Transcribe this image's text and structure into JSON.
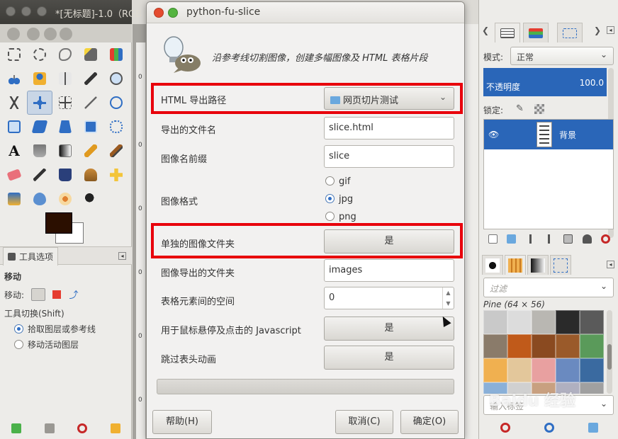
{
  "background_window": {
    "title": "*[无标题]-1.0（RGB"
  },
  "toolbox": {
    "tool_options_tab": "工具选项",
    "move_section_title": "移动",
    "move_label": "移动:",
    "tool_toggle_label": "工具切换(Shift)",
    "option_pick_layer": "拾取图层或参考线",
    "option_move_active": "移动活动图层",
    "ruler_marks": [
      "0",
      "0",
      "0",
      "0",
      "0",
      "0"
    ]
  },
  "layers_panel": {
    "mode_label": "模式:",
    "mode_value": "正常",
    "opacity_label": "不透明度",
    "opacity_value": "100.0",
    "lock_label": "锁定:",
    "layer_name": "背景"
  },
  "patterns_panel": {
    "filter_placeholder": "过滤",
    "pattern_name": "Pine (64 × 56)",
    "tag_placeholder": "输入标签"
  },
  "dialog": {
    "title": "python-fu-slice",
    "description": "沿参考线切割图像，创建多幅图像及 HTML 表格片段",
    "fields": {
      "html_path_label": "HTML 导出路径",
      "html_path_value": "网页切片测试",
      "filename_label": "导出的文件名",
      "filename_value": "slice.html",
      "prefix_label": "图像名前缀",
      "prefix_value": "slice",
      "format_label": "图像格式",
      "format_options": [
        "gif",
        "jpg",
        "png"
      ],
      "format_selected": "jpg",
      "separate_folder_label": "单独的图像文件夹",
      "separate_folder_value": "是",
      "image_folder_label": "图像导出的文件夹",
      "image_folder_value": "images",
      "cell_space_label": "表格元素间的空间",
      "cell_space_value": "0",
      "javascript_label": "用于鼠标悬停及点击的 Javascript",
      "javascript_value": "是",
      "skip_caps_label": "跳过表头动画",
      "skip_caps_value": "是"
    },
    "buttons": {
      "help": "帮助(H)",
      "cancel": "取消(C)",
      "ok": "确定(O)"
    }
  },
  "watermark": "Baidu 经验",
  "colors": {
    "highlight": "#e8000b",
    "selection": "#2a66b8",
    "foreground_color": "#2b0f00",
    "background_color": "#ffffff"
  }
}
